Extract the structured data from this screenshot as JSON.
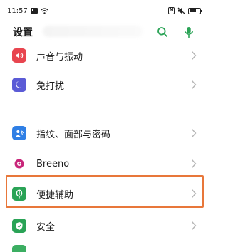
{
  "status_bar": {
    "time": "11:57",
    "nfc": "N"
  },
  "header": {
    "title": "设置"
  },
  "colors": {
    "accent": "#2aa356",
    "highlight": "#e8773a",
    "sound": "#e8454f",
    "dnd": "#5b5bd6",
    "fingerprint": "#2f7fe5",
    "breeno": "#c8267a",
    "accessibility": "#2aa356",
    "security": "#2aa356"
  },
  "settings": [
    {
      "label": "声音与振动",
      "icon": "volume-icon"
    },
    {
      "label": "免打扰",
      "icon": "moon-icon"
    },
    {
      "label": "指纹、面部与密码",
      "icon": "fingerprint-face-icon"
    },
    {
      "label": "Breeno",
      "icon": "breeno-icon"
    },
    {
      "label": "便捷辅助",
      "icon": "hand-icon"
    },
    {
      "label": "安全",
      "icon": "shield-icon"
    }
  ]
}
